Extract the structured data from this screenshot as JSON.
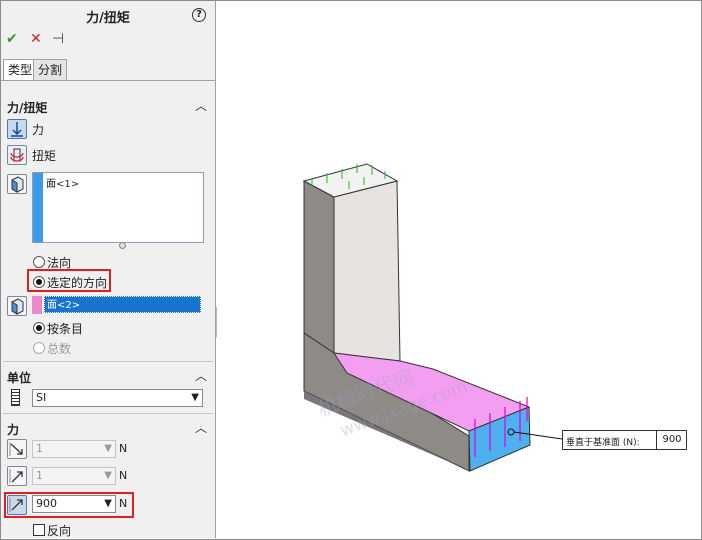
{
  "panel": {
    "title": "力/扭矩",
    "help": "?",
    "toolbar": {
      "ok": "✔",
      "cancel": "✕",
      "pin": "⊣"
    },
    "tabs": [
      {
        "label": "类型"
      },
      {
        "label": "分割"
      }
    ]
  },
  "force_torque": {
    "header": "力/扭矩",
    "force_label": "力",
    "torque_label": "扭矩",
    "faces": [
      "面<1>"
    ],
    "normal_label": "法向",
    "selected_dir_label": "选定的方向",
    "direction_ref": "面<2>",
    "per_item_label": "按条目",
    "total_label": "总数"
  },
  "units": {
    "header": "单位",
    "value": "SI"
  },
  "force": {
    "header": "力",
    "fields": [
      {
        "value": "1",
        "unit": "N"
      },
      {
        "value": "1",
        "unit": "N"
      },
      {
        "value": "900",
        "unit": "N"
      }
    ],
    "reverse_label": "反向"
  },
  "viewport": {
    "callout_label": "垂直于基准面 (N):",
    "callout_value": "900",
    "watermark_1": "机械时代网",
    "watermark_2": "www.jxage.com"
  },
  "colors": {
    "accent": "#3a9bea",
    "highlight": "#e02020",
    "magenta": "#ff66ee",
    "selection": "#1874cf"
  }
}
